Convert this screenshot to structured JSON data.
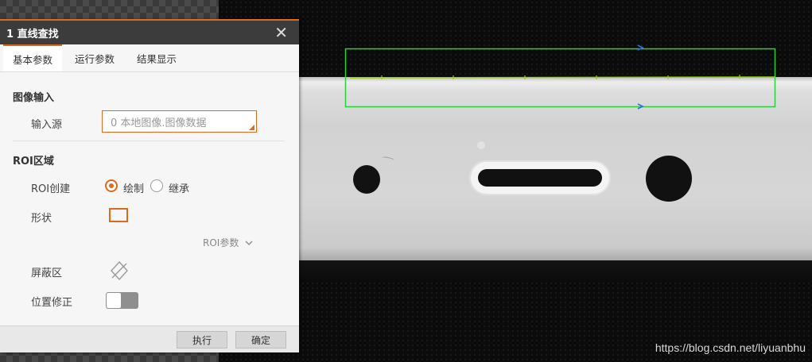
{
  "dialog": {
    "title": "1 直线查找",
    "close_symbol": "✕",
    "tabs": [
      {
        "label": "基本参数",
        "active": true
      },
      {
        "label": "运行参数",
        "active": false
      },
      {
        "label": "结果显示",
        "active": false
      }
    ],
    "image_input": {
      "section_title": "图像输入",
      "source_label": "输入源",
      "source_value": "0 本地图像.图像数据"
    },
    "roi": {
      "section_title": "ROI区域",
      "create_label": "ROI创建",
      "option_draw": "绘制",
      "option_inherit": "继承",
      "selected": "绘制",
      "shape_label": "形状",
      "params_label": "ROI参数",
      "mask_label": "屏蔽区",
      "position_fix_label": "位置修正",
      "position_fix_on": false
    },
    "buttons": {
      "execute": "执行",
      "confirm": "确定"
    }
  },
  "watermark": "https://blog.csdn.net/liyuanbhu",
  "colors": {
    "accent": "#e06a1b",
    "roi_box": "#2ecc40",
    "caliper_arrow": "#2f6fd6",
    "title_bar": "#3c3c3c"
  }
}
